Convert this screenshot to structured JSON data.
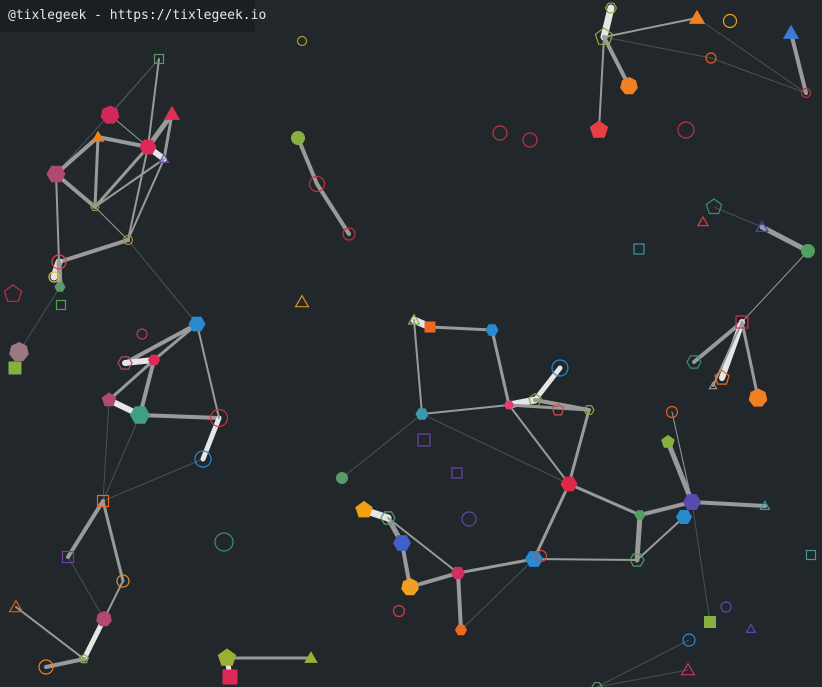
{
  "credit": {
    "text": "@tixlegeek - https://tixlegeek.io"
  },
  "colors": {
    "background": "#21272a",
    "credit_background": "#1a1f22",
    "edge_strong": "#9a9a9a",
    "edge_bright": "#e6e6e6",
    "edge_faint": "#4a5257"
  },
  "scene": {
    "shape_kinds": [
      "circle",
      "triangle",
      "square",
      "pentagon",
      "hexagon",
      "heptagon"
    ],
    "icons": [
      "network-node",
      "network-edge"
    ]
  }
}
